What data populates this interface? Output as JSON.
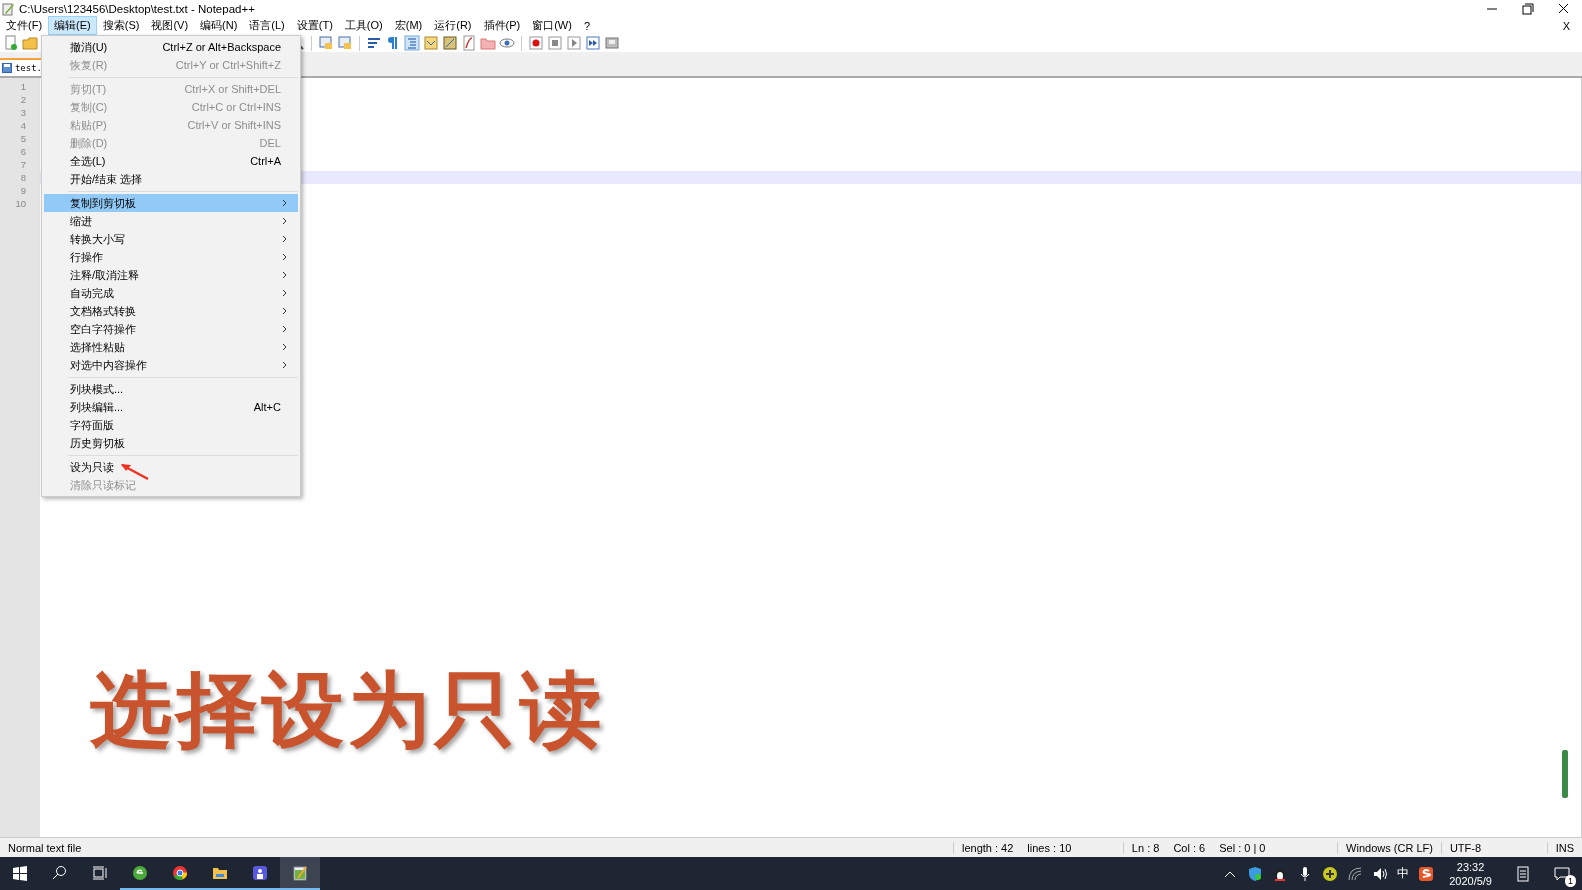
{
  "window": {
    "title": "C:\\Users\\123456\\Desktop\\test.txt - Notepad++",
    "close_doc": "X"
  },
  "menu_bar": [
    {
      "label": "文件(F)",
      "selected": false
    },
    {
      "label": "编辑(E)",
      "selected": true
    },
    {
      "label": "搜索(S)",
      "selected": false
    },
    {
      "label": "视图(V)",
      "selected": false
    },
    {
      "label": "编码(N)",
      "selected": false
    },
    {
      "label": "语言(L)",
      "selected": false
    },
    {
      "label": "设置(T)",
      "selected": false
    },
    {
      "label": "工具(O)",
      "selected": false
    },
    {
      "label": "宏(M)",
      "selected": false
    },
    {
      "label": "运行(R)",
      "selected": false
    },
    {
      "label": "插件(P)",
      "selected": false
    },
    {
      "label": "窗口(W)",
      "selected": false
    },
    {
      "label": "?",
      "selected": false
    }
  ],
  "tab": {
    "label": "test."
  },
  "edit_menu": [
    [
      {
        "label": "撤消(U)",
        "shortcut": "Ctrl+Z or Alt+Backspace",
        "disabled": false,
        "submenu": false,
        "selected": false
      },
      {
        "label": "恢复(R)",
        "shortcut": "Ctrl+Y or Ctrl+Shift+Z",
        "disabled": true,
        "submenu": false,
        "selected": false
      }
    ],
    [
      {
        "label": "剪切(T)",
        "shortcut": "Ctrl+X or Shift+DEL",
        "disabled": true,
        "submenu": false,
        "selected": false
      },
      {
        "label": "复制(C)",
        "shortcut": "Ctrl+C or Ctrl+INS",
        "disabled": true,
        "submenu": false,
        "selected": false
      },
      {
        "label": "粘贴(P)",
        "shortcut": "Ctrl+V or Shift+INS",
        "disabled": true,
        "submenu": false,
        "selected": false
      },
      {
        "label": "删除(D)",
        "shortcut": "DEL",
        "disabled": true,
        "submenu": false,
        "selected": false
      },
      {
        "label": "全选(L)",
        "shortcut": "Ctrl+A",
        "disabled": false,
        "submenu": false,
        "selected": false
      },
      {
        "label": "开始/结束 选择",
        "disabled": false,
        "submenu": false,
        "selected": false
      }
    ],
    [
      {
        "label": "复制到剪切板",
        "disabled": false,
        "submenu": true,
        "selected": true
      },
      {
        "label": "缩进",
        "disabled": false,
        "submenu": true,
        "selected": false
      },
      {
        "label": "转换大小写",
        "disabled": false,
        "submenu": true,
        "selected": false
      },
      {
        "label": "行操作",
        "disabled": false,
        "submenu": true,
        "selected": false
      },
      {
        "label": "注释/取消注释",
        "disabled": false,
        "submenu": true,
        "selected": false
      },
      {
        "label": "自动完成",
        "disabled": false,
        "submenu": true,
        "selected": false
      },
      {
        "label": "文档格式转换",
        "disabled": false,
        "submenu": true,
        "selected": false
      },
      {
        "label": "空白字符操作",
        "disabled": false,
        "submenu": true,
        "selected": false
      },
      {
        "label": "选择性粘贴",
        "disabled": false,
        "submenu": true,
        "selected": false
      },
      {
        "label": "对选中内容操作",
        "disabled": false,
        "submenu": true,
        "selected": false
      }
    ],
    [
      {
        "label": "列块模式...",
        "disabled": false,
        "submenu": false,
        "selected": false
      },
      {
        "label": "列块编辑...",
        "shortcut": "Alt+C",
        "disabled": false,
        "submenu": false,
        "selected": false
      },
      {
        "label": "字符面版",
        "disabled": false,
        "submenu": false,
        "selected": false
      },
      {
        "label": "历史剪切板",
        "disabled": false,
        "submenu": false,
        "selected": false
      }
    ],
    [
      {
        "label": "设为只读",
        "disabled": false,
        "submenu": false,
        "selected": false
      },
      {
        "label": "清除只读标记",
        "disabled": true,
        "submenu": false,
        "selected": false
      }
    ]
  ],
  "editor": {
    "lines": [
      {
        "number": "1",
        "current": false
      },
      {
        "number": "2",
        "current": false
      },
      {
        "number": "3",
        "current": false
      },
      {
        "number": "4",
        "current": false
      },
      {
        "number": "5",
        "current": false
      },
      {
        "number": "6",
        "current": false
      },
      {
        "number": "7",
        "current": false
      },
      {
        "number": "8",
        "current": true
      },
      {
        "number": "9",
        "current": false
      },
      {
        "number": "10",
        "current": false
      }
    ]
  },
  "caption": "选择设为只读",
  "status_bar": {
    "file_type": "Normal text file",
    "length": "length : 42",
    "lines": "lines : 10",
    "ln": "Ln : 8",
    "col": "Col : 6",
    "sel": "Sel : 0 | 0",
    "eol": "Windows (CR LF)",
    "encoding": "UTF-8",
    "mode": "INS"
  },
  "taskbar": {
    "ime": "中",
    "time": "23:32",
    "date": "2020/5/9",
    "notifications": "1"
  }
}
